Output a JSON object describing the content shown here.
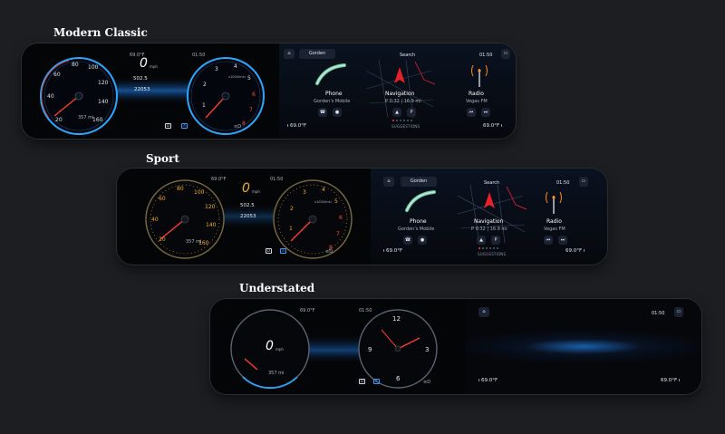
{
  "sections": {
    "modern_classic": "Modern Classic",
    "sport": "Sport",
    "understated": "Understated"
  },
  "cluster": {
    "temp": "69.0°F",
    "time": "01:50",
    "speed": "0",
    "speed_unit": "mph",
    "trip": "502.5",
    "odo": "22053",
    "range": "357 mi",
    "gear": "D",
    "auto": "A",
    "rpm_unit": "x1000/min",
    "speed_ticks": [
      "20",
      "40",
      "60",
      "80",
      "100",
      "120",
      "140",
      "160"
    ],
    "rpm_ticks": [
      "1",
      "2",
      "3",
      "4",
      "5",
      "6",
      "7",
      "8"
    ],
    "clock_ticks": [
      "12",
      "3",
      "6",
      "9"
    ]
  },
  "mbux": {
    "profile": "Gorden",
    "search": "Search",
    "status_time": "01:50",
    "phone": {
      "title": "Phone",
      "sub": "Gorden's Mobile"
    },
    "navigation": {
      "title": "Navigation",
      "sub": "P 0:32 | 16.9 mi"
    },
    "radio": {
      "title": "Radio",
      "sub": "Vegas FM"
    },
    "suggestions": "SUGGESTIONS",
    "temp_left": "69.0",
    "temp_right": "69.0",
    "temp_unit": "°F",
    "phone_btn": "☎",
    "contacts_btn": "●",
    "parking_btn": "P",
    "nav_btn": "▲",
    "prev_btn": "⏮",
    "next_btn": "⏭",
    "home_icon": "⌂"
  },
  "colors": {
    "blue_accent": "#2aa8ff",
    "sport_amber": "#f2b01e",
    "red_needle": "#ff3b30",
    "nav_red": "#e8202a",
    "phone_green": "#4fd08c",
    "radio_orange": "#ff8a1e"
  }
}
